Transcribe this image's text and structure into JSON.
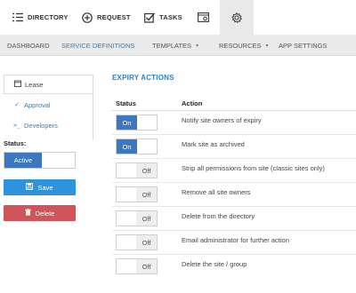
{
  "topnav": {
    "items": [
      {
        "label": "DIRECTORY",
        "icon": "list-icon"
      },
      {
        "label": "REQUEST",
        "icon": "plus-circle-icon"
      },
      {
        "label": "TASKS",
        "icon": "checkbox-icon"
      },
      {
        "label": "",
        "icon": "settings-window-icon"
      },
      {
        "label": "",
        "icon": "gear-icon"
      }
    ]
  },
  "subnav": {
    "items": [
      {
        "label": "DASHBOARD"
      },
      {
        "label": "SERVICE DEFINITIONS"
      },
      {
        "label": "TEMPLATES"
      },
      {
        "label": "RESOURCES"
      },
      {
        "label": "APP SETTINGS"
      }
    ]
  },
  "sidebar": {
    "items": [
      {
        "label": "Lease",
        "icon": "calendar-icon"
      },
      {
        "label": "Approval",
        "icon": "check-icon"
      },
      {
        "label": "Developers",
        "icon": "terminal-icon"
      }
    ],
    "status_label": "Status:",
    "status_value": "Active",
    "save_label": "Save",
    "delete_label": "Delete"
  },
  "main": {
    "title": "EXPIRY ACTIONS",
    "columns": [
      "Status",
      "Action"
    ],
    "rows": [
      {
        "status": "On",
        "action": "Notify site owners of expiry"
      },
      {
        "status": "On",
        "action": "Mark site as archived"
      },
      {
        "status": "Off",
        "action": "Strip all permissions from site (classic sites only)"
      },
      {
        "status": "Off",
        "action": "Remove all site owners"
      },
      {
        "status": "Off",
        "action": "Delete from the directory"
      },
      {
        "status": "Off",
        "action": "Email administrator for further action"
      },
      {
        "status": "Off",
        "action": "Delete the site / group"
      }
    ]
  },
  "colors": {
    "accent": "#2a83c6",
    "toggle_on": "#3b78c0",
    "save": "#2d93dc",
    "delete": "#d1545a"
  }
}
